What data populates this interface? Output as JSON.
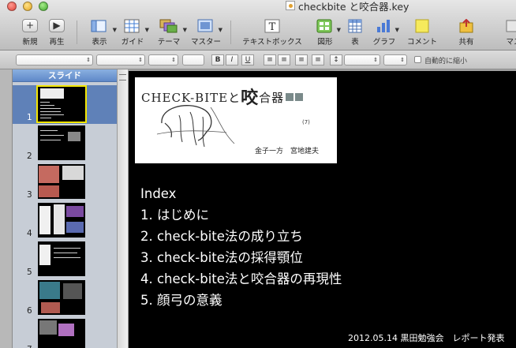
{
  "window": {
    "title": "checkbite と咬合器.key"
  },
  "toolbar": {
    "items": [
      {
        "label": "新規",
        "icon": "plus-icon"
      },
      {
        "label": "再生",
        "icon": "play-icon"
      },
      {
        "label": "表示",
        "icon": "view-icon"
      },
      {
        "label": "ガイド",
        "icon": "guides-icon"
      },
      {
        "label": "テーマ",
        "icon": "themes-icon"
      },
      {
        "label": "マスター",
        "icon": "masters-icon"
      },
      {
        "label": "テキストボックス",
        "icon": "text-box-icon"
      },
      {
        "label": "図形",
        "icon": "shapes-icon"
      },
      {
        "label": "表",
        "icon": "table-icon"
      },
      {
        "label": "グラフ",
        "icon": "chart-icon"
      },
      {
        "label": "コメント",
        "icon": "comment-icon"
      },
      {
        "label": "共有",
        "icon": "share-icon"
      },
      {
        "label": "マス",
        "icon": "mask-icon"
      }
    ]
  },
  "format_bar": {
    "bold": "B",
    "italic": "I",
    "underline": "U",
    "shrink_label": "自動的に縮小"
  },
  "navigator": {
    "header": "スライド",
    "slides": [
      {
        "number": "1",
        "selected": true
      },
      {
        "number": "2",
        "selected": false
      },
      {
        "number": "3",
        "selected": false
      },
      {
        "number": "4",
        "selected": false
      },
      {
        "number": "5",
        "selected": false
      },
      {
        "number": "6",
        "selected": false
      },
      {
        "number": "7",
        "selected": false
      }
    ]
  },
  "slide": {
    "cover": {
      "title_prefix": "CHECK-BITEと",
      "title_big": "咬",
      "title_suffix": "合器",
      "page": "(7)",
      "authors": "金子一方　宮地建夫"
    },
    "lines": [
      "Index",
      "1. はじめに",
      "2. check-bite法の成り立ち",
      "3. check-bite法の採得顎位",
      "4. check-bite法と咬合器の再現性",
      "5. 顔弓の意義"
    ],
    "footer": "2012.05.14 黒田勉強会　レポート発表"
  },
  "colors": {
    "slide_background": "#000000",
    "selection": "#5f81b8",
    "selection_outline": "#f3e600"
  }
}
